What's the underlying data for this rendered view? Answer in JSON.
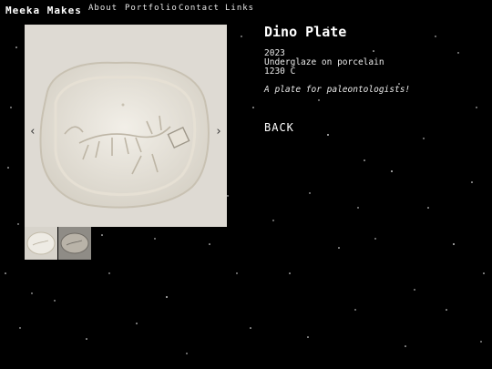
{
  "site": {
    "brand": "Meeka Makes"
  },
  "nav": {
    "items": [
      "About",
      "Portfolio",
      "Contact",
      "Links"
    ]
  },
  "gallery": {
    "prev_icon": "chevron-left-icon",
    "next_icon": "chevron-right-icon",
    "prev_glyph": "‹",
    "next_glyph": "›",
    "selected_thumbnail": 1
  },
  "artwork": {
    "title": "Dino Plate",
    "year": "2023",
    "medium": "Underglaze on porcelain",
    "firing": "1230 C",
    "description": "A plate for paleontologists!"
  },
  "back_label": "BACK",
  "colors": {
    "background": "#000000",
    "text": "#ffffff",
    "plate": "#dedad3"
  }
}
